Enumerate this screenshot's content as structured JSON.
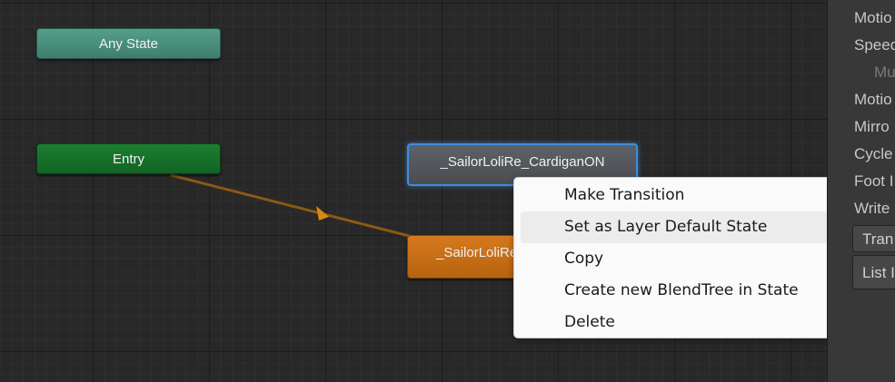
{
  "graph": {
    "nodes": {
      "any_state": "Any State",
      "entry": "Entry",
      "cardigan_on": "_SailorLoliRe_CardiganON",
      "default_state": "_SailorLoliRe"
    },
    "colors": {
      "any_state": "#4f9382",
      "entry": "#17702a",
      "default_state": "#c96d16",
      "selected_outline": "#3d8edc",
      "transition_line": "#8a5a12",
      "transition_arrow": "#d58a12"
    }
  },
  "context_menu": {
    "items": [
      "Make Transition",
      "Set as Layer Default State",
      "Copy",
      "Create new BlendTree in State",
      "Delete"
    ]
  },
  "inspector": {
    "rows": [
      "Motio",
      "Speed",
      "Mu",
      "Motio",
      "Mirro",
      "Cycle",
      "Foot I",
      "Write"
    ],
    "transitions_label": "Tran",
    "list_label": "List I"
  }
}
